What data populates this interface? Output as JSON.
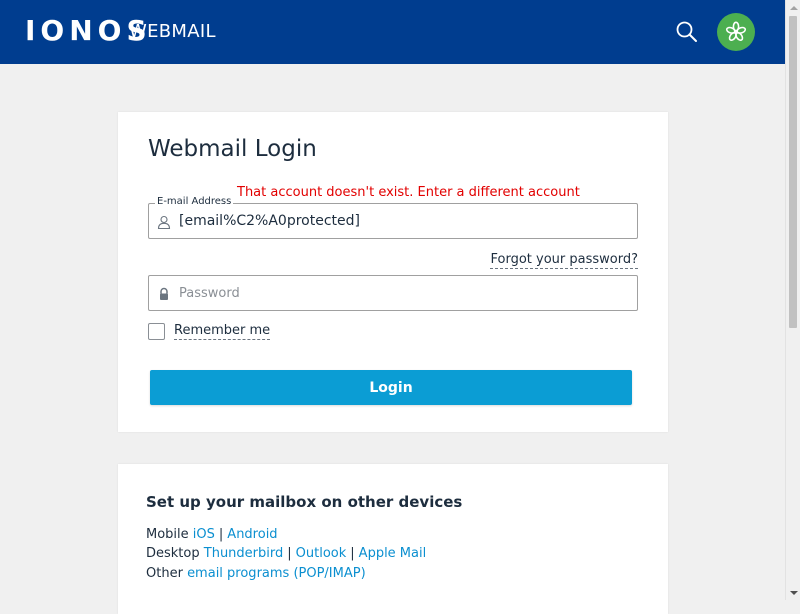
{
  "header": {
    "logo": "IONOS",
    "product": "WEBMAIL",
    "search_icon": "search-icon",
    "avatar_icon": "flower-icon",
    "colors": {
      "bar": "#003d8f",
      "avatar": "#4caf50"
    }
  },
  "login": {
    "title": "Webmail Login",
    "error": "That account doesn't exist. Enter a different account",
    "email_label": "E-mail Address",
    "email_value": "[email%C2%A0protected]",
    "email_icon": "user-icon",
    "forgot": "Forgot your password?",
    "password_placeholder": "Password",
    "password_icon": "lock-icon",
    "remember": "Remember me",
    "remember_checked": false,
    "button": "Login",
    "colors": {
      "error": "#e20000",
      "button": "#0b9dd4"
    }
  },
  "devices": {
    "title": "Set up your mailbox on other devices",
    "mobile": {
      "label": "Mobile",
      "links": [
        "iOS",
        "Android"
      ]
    },
    "desktop": {
      "label": "Desktop",
      "links": [
        "Thunderbird",
        "Outlook",
        "Apple Mail"
      ]
    },
    "other": {
      "label": "Other",
      "links": [
        "email programs (POP/IMAP)"
      ]
    },
    "colors": {
      "link": "#0b8fd0"
    }
  }
}
